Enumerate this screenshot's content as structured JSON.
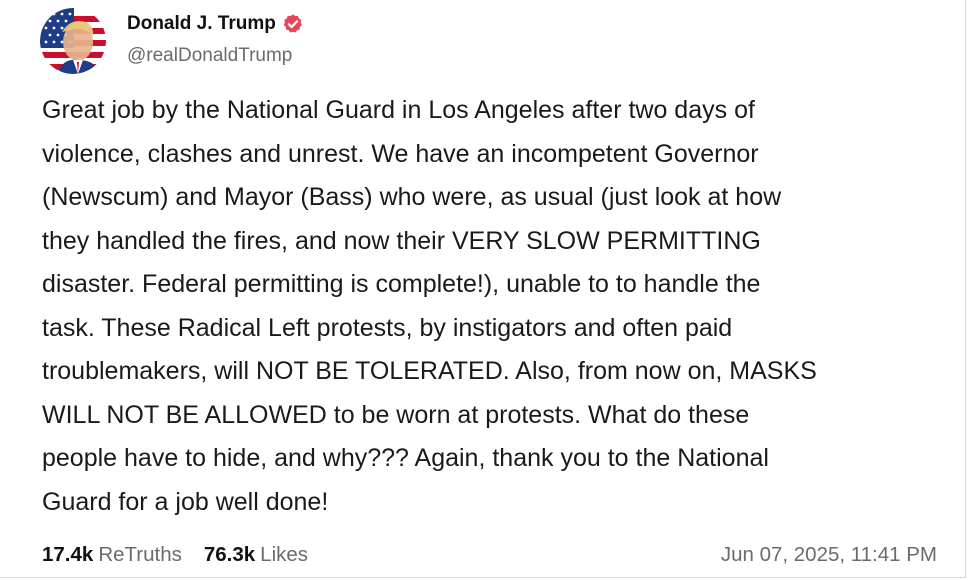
{
  "author": {
    "display_name": "Donald J. Trump",
    "handle": "@realDonaldTrump",
    "verified_icon": "verified-badge-icon"
  },
  "post": {
    "text": "Great job by the National Guard in Los Angeles after two days of\nviolence, clashes and unrest. We have an incompetent Governor\n(Newscum) and Mayor (Bass) who were, as usual (just look at how\nthey handled the fires, and now their VERY SLOW PERMITTING\ndisaster. Federal permitting is complete!), unable to to handle the\ntask. These Radical Left protests, by instigators and often paid\ntroublemakers, will NOT BE TOLERATED. Also, from now on, MASKS\nWILL NOT BE ALLOWED to be worn at protests. What do these\npeople have to hide, and why??? Again, thank you to the National\nGuard for a job well done!"
  },
  "stats": {
    "retruths_count": "17.4k",
    "retruths_label": "ReTruths",
    "likes_count": "76.3k",
    "likes_label": "Likes"
  },
  "timestamp": "Jun 07, 2025, 11:41 PM",
  "colors": {
    "verified": "#e8475a",
    "muted_text": "#6b6b6b",
    "body_text": "#1a1a1a"
  }
}
